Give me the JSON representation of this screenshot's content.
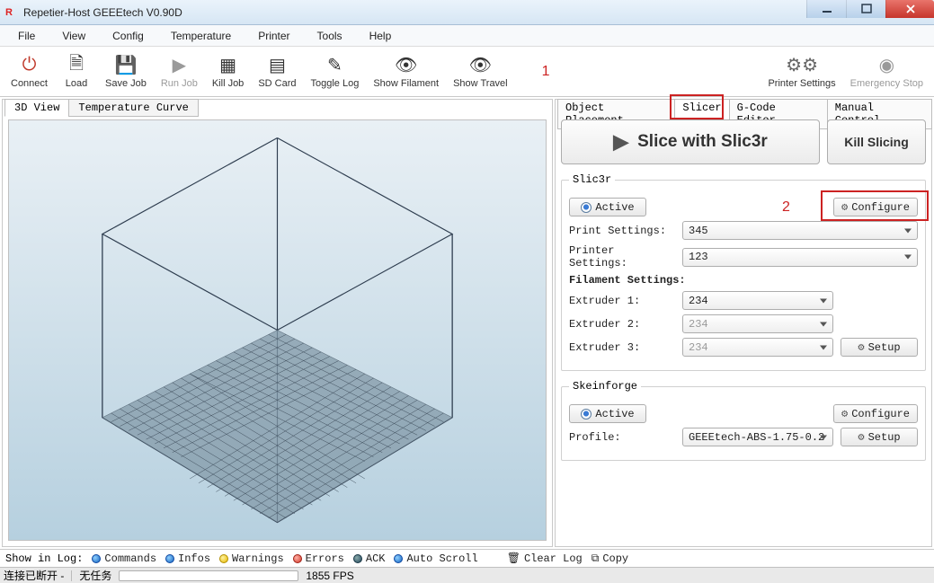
{
  "window": {
    "title": "Repetier-Host GEEEtech V0.90D"
  },
  "menu": {
    "items": [
      "File",
      "View",
      "Config",
      "Temperature",
      "Printer",
      "Tools",
      "Help"
    ]
  },
  "toolbar": {
    "connect": "Connect",
    "load": "Load",
    "savejob": "Save Job",
    "runjob": "Run Job",
    "killjob": "Kill Job",
    "sdcard": "SD Card",
    "togglelog": "Toggle Log",
    "showfil": "Show Filament",
    "showtrav": "Show Travel",
    "prsettings": "Printer Settings",
    "estop": "Emergency Stop"
  },
  "lefttabs": {
    "view3d": "3D View",
    "tempcurve": "Temperature Curve"
  },
  "righttabs": {
    "obj": "Object Placement",
    "slicer": "Slicer",
    "gcode": "G-Code Editor",
    "manual": "Manual Control"
  },
  "annotations": {
    "one": "1",
    "two": "2"
  },
  "slicer": {
    "slice_label": "Slice with Slic3r",
    "kill_label": "Kill Slicing",
    "sect1": "Slic3r",
    "active": "Active",
    "configure": "Configure",
    "print_label": "Print Settings:",
    "print_val": "345",
    "printer_label": "Printer Settings:",
    "printer_val": "123",
    "fil_heading": "Filament Settings:",
    "ext1_label": "Extruder 1:",
    "ext1_val": "234",
    "ext2_label": "Extruder 2:",
    "ext2_val": "234",
    "ext3_label": "Extruder 3:",
    "ext3_val": "234",
    "setup": "Setup",
    "sect2": "Skeinforge",
    "profile_label": "Profile:",
    "profile_val": "GEEEtech-ABS-1.75-0.2"
  },
  "logbar": {
    "showin": "Show in Log:",
    "commands": "Commands",
    "infos": "Infos",
    "warnings": "Warnings",
    "errors": "Errors",
    "ack": "ACK",
    "autoscroll": "Auto Scroll",
    "clear": "Clear Log",
    "copy": "Copy"
  },
  "status": {
    "conn": "连接已断开 -",
    "task": "无任务",
    "fps": "1855 FPS"
  }
}
